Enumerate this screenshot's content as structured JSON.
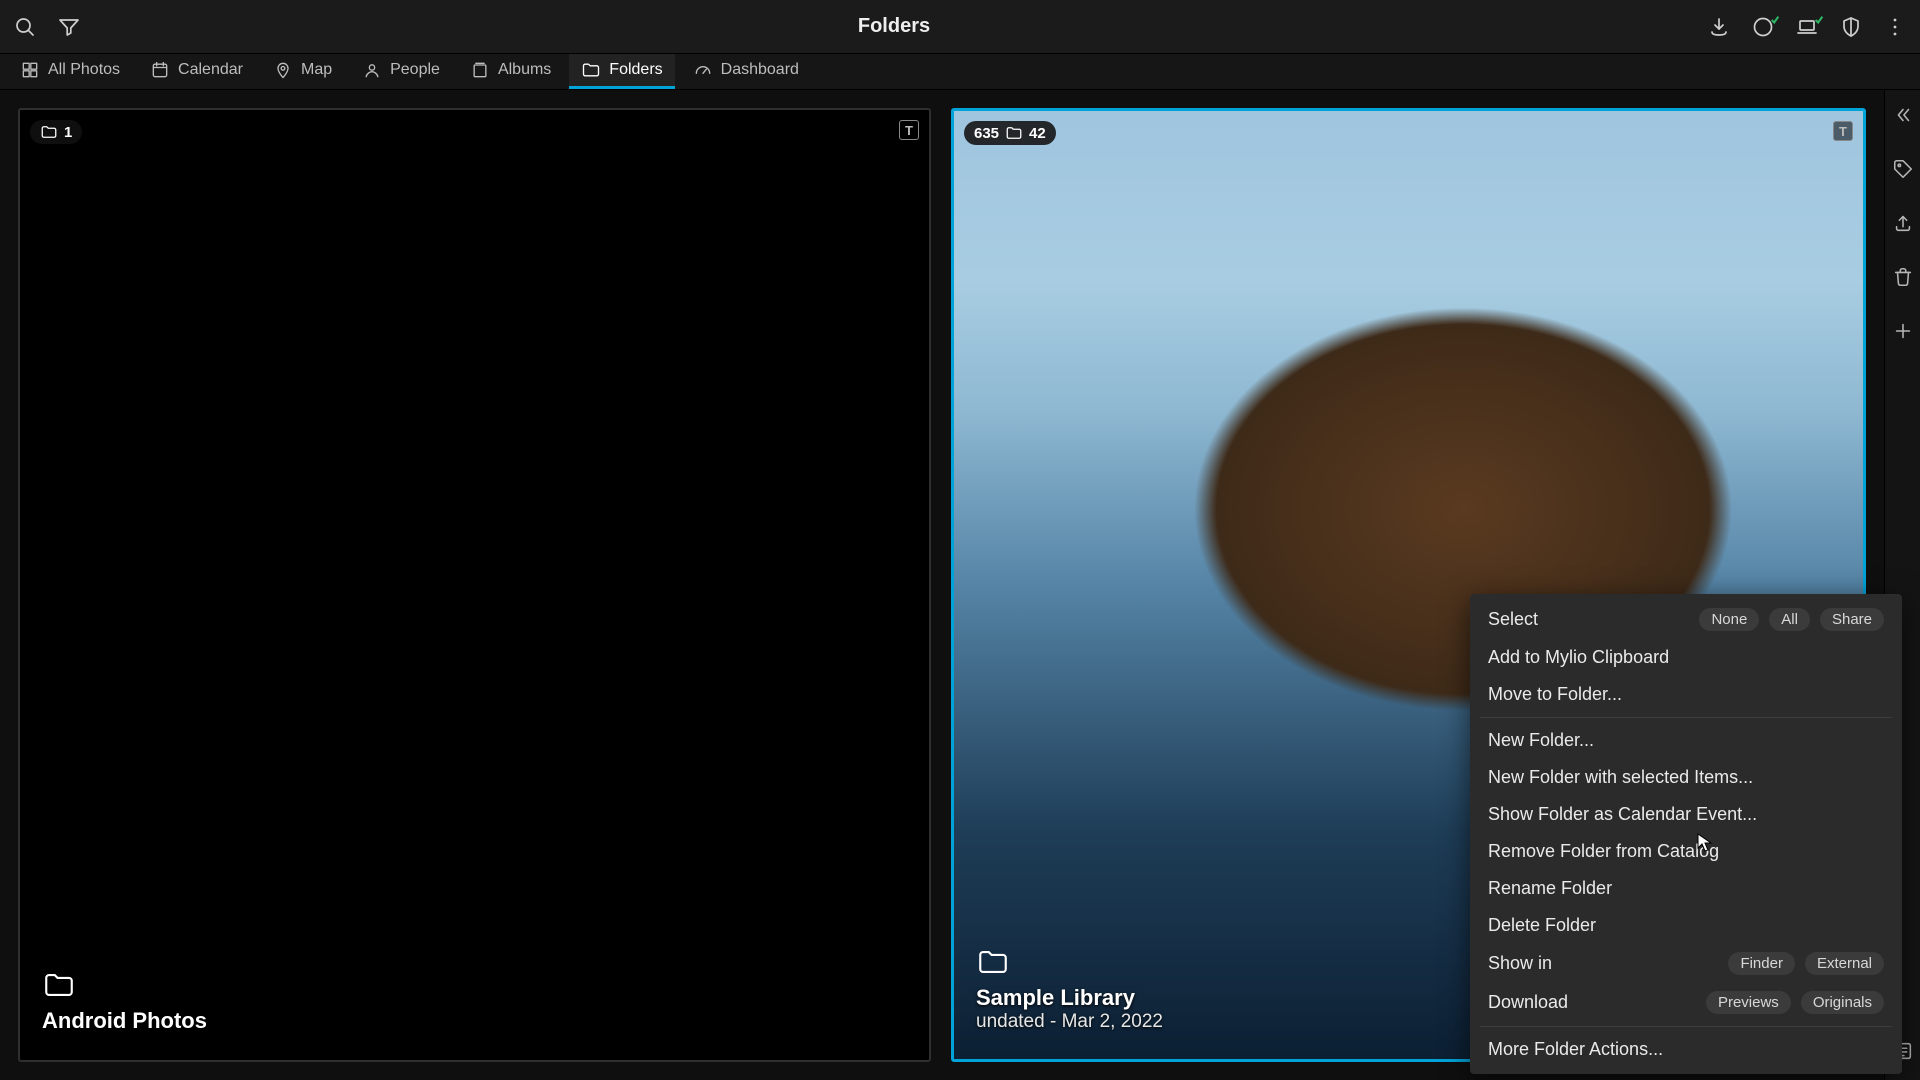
{
  "header": {
    "title": "Folders"
  },
  "nav": {
    "items": [
      {
        "label": "All Photos"
      },
      {
        "label": "Calendar"
      },
      {
        "label": "Map"
      },
      {
        "label": "People"
      },
      {
        "label": "Albums"
      },
      {
        "label": "Folders"
      },
      {
        "label": "Dashboard"
      }
    ],
    "active_index": 5
  },
  "tiles": [
    {
      "title": "Android Photos",
      "subtitle": "",
      "photo_count": "",
      "folder_count": "1",
      "badge_t": "T"
    },
    {
      "title": "Sample Library",
      "subtitle": "undated - Mar 2, 2022",
      "photo_count": "635",
      "folder_count": "42",
      "badge_t": "T"
    }
  ],
  "context_menu": {
    "select_label": "Select",
    "select_none": "None",
    "select_all": "All",
    "select_share": "Share",
    "add_clipboard": "Add to Mylio Clipboard",
    "move": "Move to Folder...",
    "new_folder": "New Folder...",
    "new_folder_selected": "New Folder with selected Items...",
    "show_calendar": "Show Folder as Calendar Event...",
    "remove_catalog": "Remove Folder from Catalog",
    "rename": "Rename Folder",
    "delete": "Delete Folder",
    "show_in_label": "Show in",
    "show_in_finder": "Finder",
    "show_in_external": "External",
    "download_label": "Download",
    "download_previews": "Previews",
    "download_originals": "Originals",
    "more": "More Folder Actions..."
  }
}
